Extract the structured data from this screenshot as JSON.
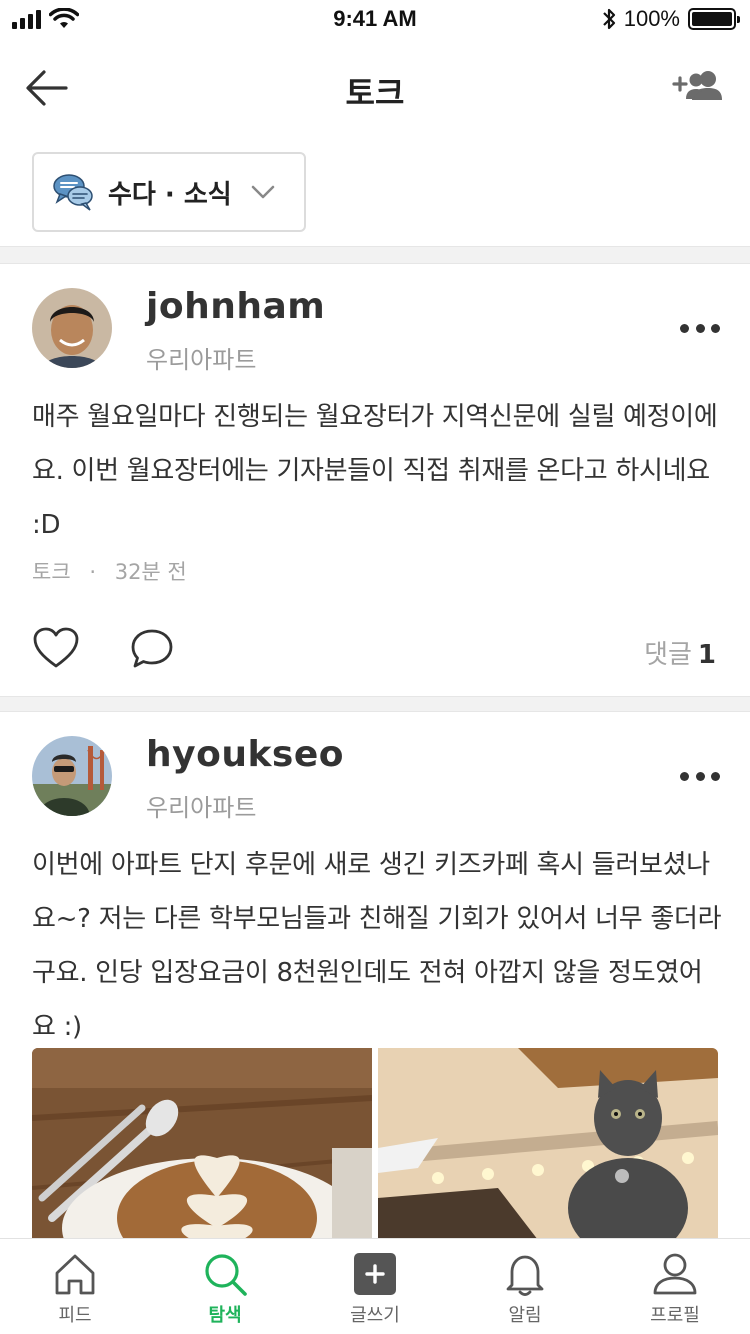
{
  "status_bar": {
    "time": "9:41 AM",
    "battery": "100%",
    "battery_level": 1.0
  },
  "header": {
    "title": "토크",
    "back_icon": "back-arrow-icon",
    "add_friend_icon": "add-friend-icon"
  },
  "category": {
    "icon": "chat-bubbles-icon",
    "label": "수다 · 소식",
    "chevron": "chevron-down-icon"
  },
  "posts": [
    {
      "username": "johnham",
      "location": "우리아파트",
      "body": "매주 월요일마다 진행되는 월요장터가 지역신문에 실릴 예정이에요. 이번 월요장터에는 기자분들이 직접 취재를 온다고 하시네요 :D",
      "category": "토크",
      "separator": "·",
      "time": "32분 전",
      "comment_label": "댓글",
      "comment_count": "1"
    },
    {
      "username": "hyoukseo",
      "location": "우리아파트",
      "body": "이번에 아파트 단지 후문에 새로 생긴 키즈카페 혹시 들러보셨나요~? 저는 다른 학부모님들과 친해질 기회가 있어서 너무 좋더라구요. 인당 입장요금이 8천원인데도 전혀 아깝지 않을 정도였어요 :)"
    }
  ],
  "tabs": [
    {
      "label": "피드",
      "icon": "home-icon",
      "active": false
    },
    {
      "label": "탐색",
      "icon": "search-icon",
      "active": true
    },
    {
      "label": "글쓰기",
      "icon": "write-plus-icon",
      "active": false
    },
    {
      "label": "알림",
      "icon": "bell-icon",
      "active": false
    },
    {
      "label": "프로필",
      "icon": "profile-icon",
      "active": false
    }
  ],
  "colors": {
    "accent": "#1fb35b",
    "text": "#333333",
    "muted": "#a5a5a5"
  }
}
